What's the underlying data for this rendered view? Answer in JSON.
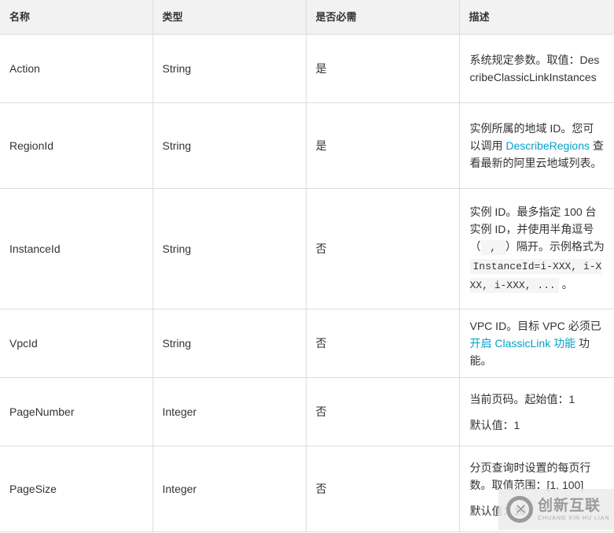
{
  "table": {
    "headers": [
      "名称",
      "类型",
      "是否必需",
      "描述"
    ],
    "rows": [
      {
        "name": "Action",
        "type": "String",
        "required": "是",
        "description": {
          "text_before": "系统规定参数。取值：DescribeClassicLinkInstances"
        }
      },
      {
        "name": "RegionId",
        "type": "String",
        "required": "是",
        "description": {
          "text_before": "实例所属的地域 ID。您可以调用 ",
          "link": "DescribeRegions",
          "text_after": " 查看最新的阿里云地域列表。"
        }
      },
      {
        "name": "InstanceId",
        "type": "String",
        "required": "否",
        "description": {
          "text_before": "实例 ID。最多指定 100 台实例 ID，并使用半角逗号（",
          "code_1": " , ",
          "text_middle": "）隔开。示例格式为 ",
          "code_2": "InstanceId=i-XXX, i-XXX, i-XXX, ...",
          "text_after": " 。"
        }
      },
      {
        "name": "VpcId",
        "type": "String",
        "required": "否",
        "description": {
          "text_before": "VPC ID。目标 VPC 必须已",
          "link": "开启 ClassicLink 功能",
          "text_after": " 功能。"
        }
      },
      {
        "name": "PageNumber",
        "type": "Integer",
        "required": "否",
        "description": {
          "line_1": "当前页码。起始值：1",
          "line_2": "默认值：1"
        }
      },
      {
        "name": "PageSize",
        "type": "Integer",
        "required": "否",
        "description": {
          "line_1": "分页查询时设置的每页行数。取值范围：[1, 100]",
          "line_2": "默认值：10"
        }
      }
    ]
  },
  "watermark": {
    "chinese": "创新互联",
    "pinyin": "CHUANG XIN HU LIAN"
  },
  "colors": {
    "link": "#00a2ca",
    "header_bg": "#f2f2f2",
    "border": "#dddddd",
    "text": "#333333"
  }
}
